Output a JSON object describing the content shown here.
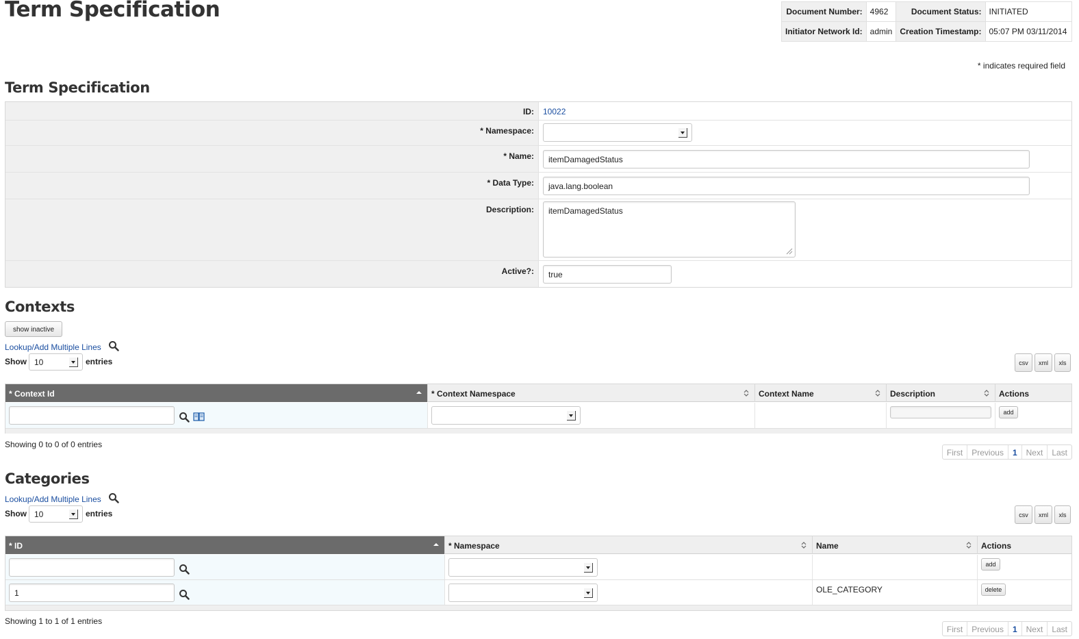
{
  "page": {
    "title": "Term Specification"
  },
  "docinfo": {
    "doc_number_label": "Document Number:",
    "doc_number": "4962",
    "doc_status_label": "Document Status:",
    "doc_status": "INITIATED",
    "initiator_label": "Initiator Network Id:",
    "initiator": "admin",
    "timestamp_label": "Creation Timestamp:",
    "timestamp": "05:07 PM 03/11/2014"
  },
  "required_note": "* indicates required field",
  "term_spec": {
    "section_title": "Term Specification",
    "id_label": "ID:",
    "id_value": "10022",
    "namespace_label": "* Namespace:",
    "namespace_value": "",
    "name_label": "* Name:",
    "name_value": "itemDamagedStatus",
    "datatype_label": "* Data Type:",
    "datatype_value": "java.lang.boolean",
    "description_label": "Description:",
    "description_value": "itemDamagedStatus",
    "active_label": "Active?:",
    "active_value": "true"
  },
  "contexts": {
    "section_title": "Contexts",
    "show_inactive_label": "show inactive",
    "lookup_label": "Lookup/Add Multiple Lines",
    "show_label": "Show",
    "entries_value": "10",
    "entries_label": "entries",
    "export": {
      "csv": "csv",
      "xml": "xml",
      "xls": "xls"
    },
    "columns": [
      "* Context Id",
      "* Context Namespace",
      "Context Name",
      "Description",
      "Actions"
    ],
    "add_label": "add",
    "showing_text": "Showing 0 to 0 of 0 entries",
    "pager": {
      "first": "First",
      "previous": "Previous",
      "page": "1",
      "next": "Next",
      "last": "Last"
    }
  },
  "categories": {
    "section_title": "Categories",
    "lookup_label": "Lookup/Add Multiple Lines",
    "show_label": "Show",
    "entries_value": "10",
    "entries_label": "entries",
    "export": {
      "csv": "csv",
      "xml": "xml",
      "xls": "xls"
    },
    "columns": [
      "* ID",
      "* Namespace",
      "Name",
      "Actions"
    ],
    "add_label": "add",
    "rows": [
      {
        "id": "1",
        "namespace": "",
        "name": "OLE_CATEGORY",
        "action": "delete"
      }
    ],
    "showing_text": "Showing 1 to 1 of 1 entries",
    "pager": {
      "first": "First",
      "previous": "Previous",
      "page": "1",
      "next": "Next",
      "last": "Last"
    }
  }
}
